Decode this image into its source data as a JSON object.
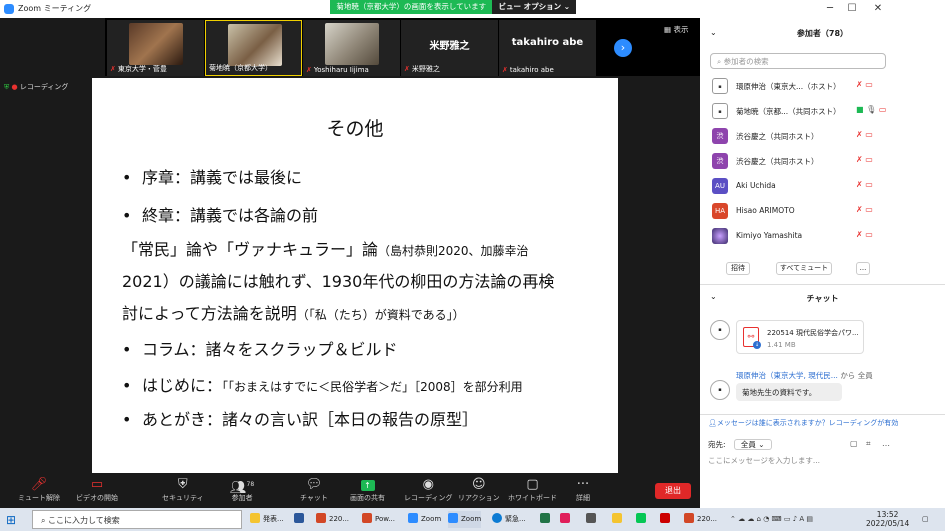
{
  "window": {
    "title": "Zoom ミーティング"
  },
  "share_banner": {
    "message": "菊地暁（京都大学）の画面を表示しています",
    "view_options": "ビュー オプション ⌄"
  },
  "thumbnails": [
    {
      "name": "東京大学・菅豊",
      "muted": true,
      "kind": "photo"
    },
    {
      "name": "菊地暁（京都大学）",
      "muted": false,
      "kind": "photo"
    },
    {
      "name": "Yoshiharu Iijima",
      "muted": true,
      "kind": "photo"
    },
    {
      "name": "米野雅之",
      "big_name": "米野雅之",
      "muted": true,
      "kind": "text"
    },
    {
      "name": "takahiro abe",
      "big_name": "takahiro abe",
      "muted": true,
      "kind": "text"
    }
  ],
  "view_label": "表示",
  "recording_label": "レコーディング",
  "slide": {
    "title": "その他",
    "b1": "序章：講義では最後に",
    "b2": "終章：講義では各論の前",
    "p1a": "「常民」論や「ヴァナキュラー」論",
    "p1b": "（島村恭則2020、加藤幸治",
    "p2": "2021）の議論には触れず、1930年代の柳田の方法論の再検",
    "p3a": "討によって方法論を説明",
    "p3b": "（「私（たち）が資料である」）",
    "b3": "コラム：諸々をスクラップ＆ビルド",
    "b4a": "はじめに：",
    "b4b": "「「おまえはすでに＜民俗学者＞だ」［2008］を部分利用",
    "b5": "あとがき：諸々の言い訳［本日の報告の原型］"
  },
  "toolbar": {
    "mute": "ミュート解除",
    "video": "ビデオの開始",
    "security": "セキュリティ",
    "participants": "参加者",
    "participants_count": "78",
    "chat": "チャット",
    "share": "画面の共有",
    "record": "レコーディング",
    "reactions": "リアクション",
    "whiteboard": "ホワイトボード",
    "more": "詳細",
    "leave": "退出"
  },
  "panel": {
    "participants_title": "参加者（78）",
    "search_placeholder": "参加者の検索",
    "participants": [
      {
        "name": "環原伸治（東京大...（ホスト）",
        "avatar": "",
        "color": "#ffffff"
      },
      {
        "name": "菊地暁（京都...（共同ホスト）",
        "avatar": "",
        "color": "#ffffff"
      },
      {
        "name": "渋谷慶之（共同ホスト）",
        "avatar": "渋",
        "color": "#8e44ad"
      },
      {
        "name": "渋谷慶之（共同ホスト）",
        "avatar": "渋",
        "color": "#8e44ad"
      },
      {
        "name": "Aki Uchida",
        "avatar": "AU",
        "color": "#5b4fc4"
      },
      {
        "name": "Hisao ARIMOTO",
        "avatar": "HA",
        "color": "#d9472b"
      },
      {
        "name": "Kimiyo Yamashita",
        "avatar": "",
        "color": "#6a5acd"
      }
    ],
    "invite": "招待",
    "mute_all": "すべてミュート",
    "more": "...",
    "chat_title": "チャット",
    "file_name": "220514 現代民俗学会パワ...",
    "file_size": "1.41 MB",
    "sender2": "環原伸治（東京大学, 現代民...",
    "sender2_to": "から 全員",
    "message": "菊地先生の資料です。",
    "notice": "メッセージは誰に表示されますか？レコーディングが有効",
    "to_label": "宛先:",
    "to_value": "全員 ⌄",
    "input_placeholder": "ここにメッセージを入力します..."
  },
  "taskbar": {
    "search": "ここに入力して検索",
    "tasks": [
      "発表...",
      "220...",
      "Pow...",
      "Zoom",
      "Zoom",
      "緊急...",
      "220..."
    ],
    "time": "13:52",
    "date": "2022/05/14",
    "ime": "A"
  }
}
